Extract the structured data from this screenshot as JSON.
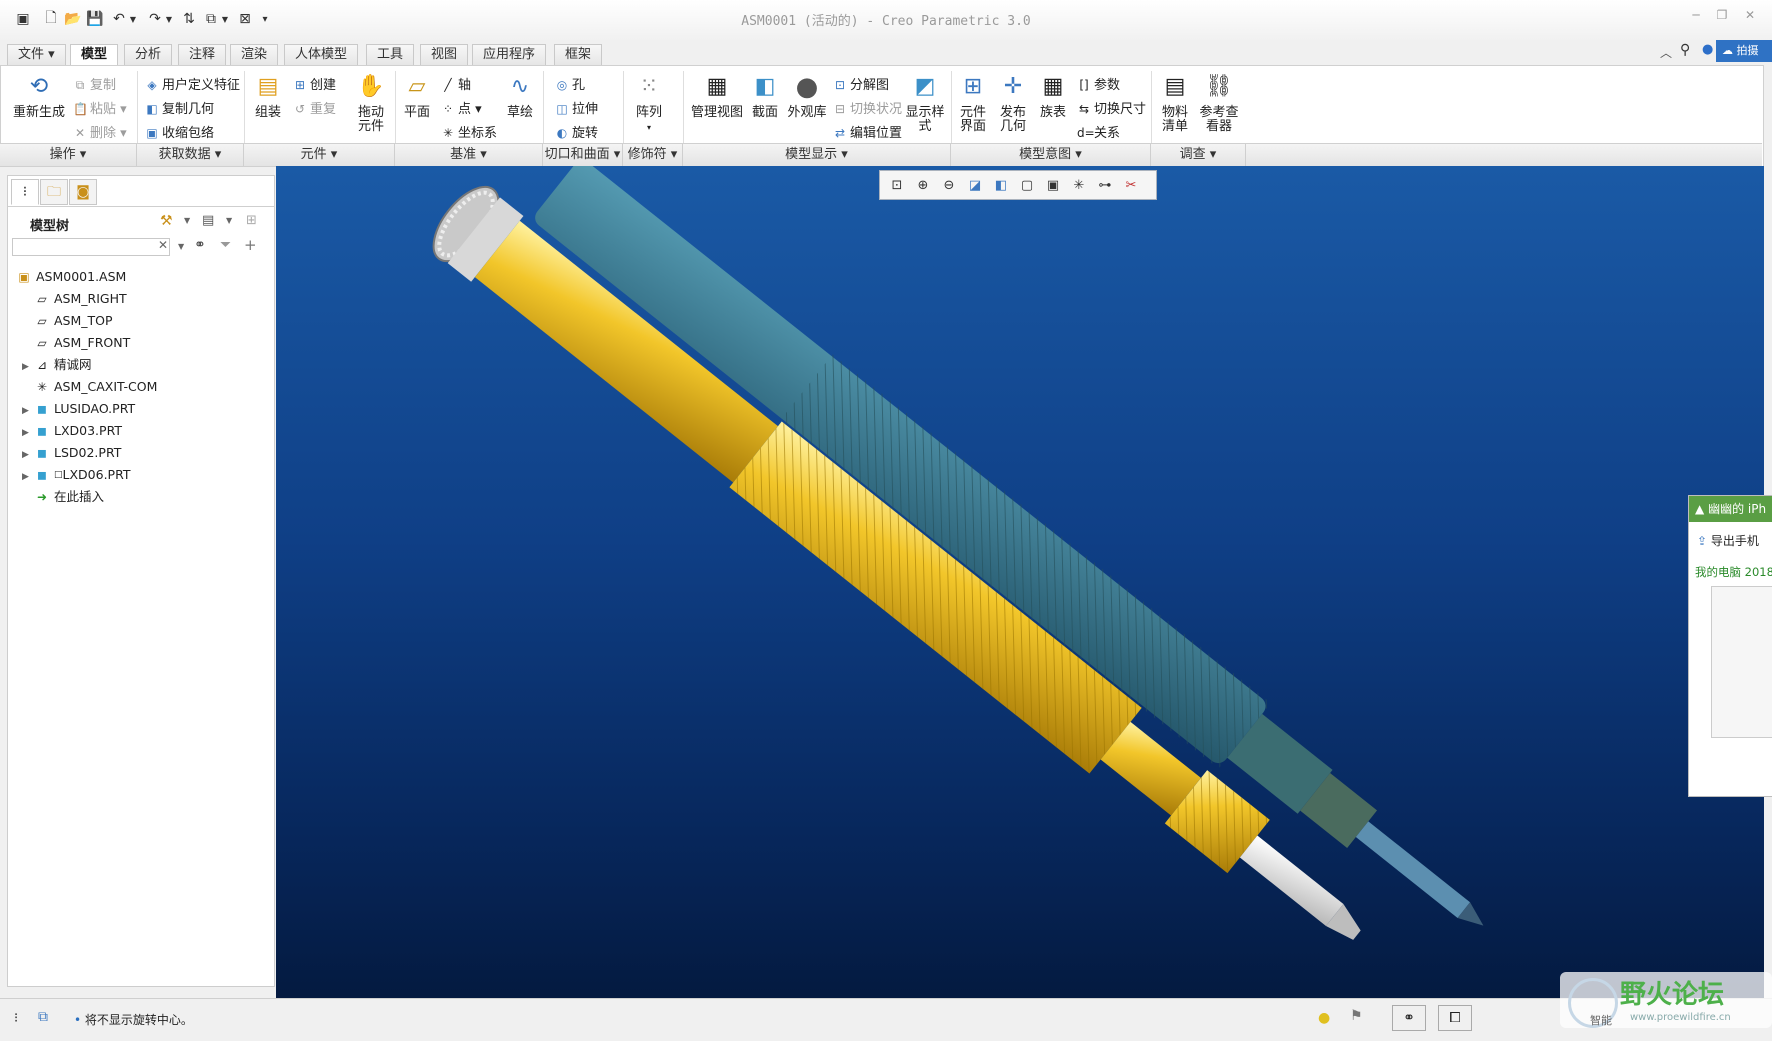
{
  "window": {
    "title": "ASM0001 (活动的) - Creo Parametric 3.0",
    "controls": [
      "minimize",
      "restore",
      "close"
    ]
  },
  "menu_tabs": [
    {
      "label": "文件",
      "has_dropdown": true
    },
    {
      "label": "模型",
      "active": true
    },
    {
      "label": "分析"
    },
    {
      "label": "注释"
    },
    {
      "label": "渲染"
    },
    {
      "label": "人体模型"
    },
    {
      "label": "工具"
    },
    {
      "label": "视图"
    },
    {
      "label": "应用程序"
    },
    {
      "label": "框架"
    }
  ],
  "ribbon": {
    "operations": {
      "regenerate": "重新生成",
      "copy": "复制",
      "paste": "粘贴",
      "delete": "删除"
    },
    "get_data": {
      "udf": "用户定义特征",
      "copy_geom": "复制几何",
      "shrinkwrap": "收缩包络"
    },
    "components": {
      "assemble": "组装",
      "create": "创建",
      "repeat": "重复",
      "drag": "拖动\n元件"
    },
    "datum": {
      "plane": "平面",
      "axis": "轴",
      "point": "点",
      "csys": "坐标系",
      "sketch": "草绘"
    },
    "cut_surface": {
      "hole": "孔",
      "extrude": "拉伸",
      "revolve": "旋转"
    },
    "modifiers": {
      "pattern": "阵列"
    },
    "model_display": {
      "manage_views": "管理视图",
      "section": "截面",
      "appearance": "外观库",
      "explode": "分解图",
      "toggle_state": "切换状况",
      "edit_position": "编辑位置",
      "display_style": "显示样\n式"
    },
    "model_intent": {
      "component_interface": "元件\n界面",
      "publish_geom": "发布\n几何",
      "family_table": "族表",
      "params": "参数",
      "switch_dims": "切换尺寸",
      "relations": "关系"
    },
    "investigate": {
      "bom": "物料\n清单",
      "ref_viewer": "参考查\n看器"
    },
    "groups": [
      "操作",
      "获取数据",
      "元件",
      "基准",
      "切口和曲面",
      "修饰符",
      "模型显示",
      "模型意图",
      "调查"
    ]
  },
  "left_panel": {
    "title": "模型树",
    "search_placeholder": "",
    "tree": [
      {
        "label": "ASM0001.ASM",
        "icon": "assembly-icon",
        "expandable": false,
        "level": 0
      },
      {
        "label": "ASM_RIGHT",
        "icon": "datum-plane-icon",
        "level": 1
      },
      {
        "label": "ASM_TOP",
        "icon": "datum-plane-icon",
        "level": 1
      },
      {
        "label": "ASM_FRONT",
        "icon": "datum-plane-icon",
        "level": 1
      },
      {
        "label": "精诚网",
        "icon": "layer-icon",
        "expandable": true,
        "level": 1
      },
      {
        "label": "ASM_CAXIT-COM",
        "icon": "csys-icon",
        "level": 1
      },
      {
        "label": "LUSIDAO.PRT",
        "icon": "part-icon",
        "expandable": true,
        "level": 1
      },
      {
        "label": "LXD03.PRT",
        "icon": "part-icon",
        "expandable": true,
        "level": 1
      },
      {
        "label": "LSD02.PRT",
        "icon": "part-icon",
        "expandable": true,
        "level": 1
      },
      {
        "label": "LXD06.PRT",
        "icon": "part-icon",
        "expandable": true,
        "level": 1,
        "prefix": "□"
      },
      {
        "label": "在此插入",
        "icon": "insert-here-icon",
        "level": 1
      }
    ]
  },
  "status": {
    "message": "将不显示旋转中心。"
  },
  "popup": {
    "title": "幽幽的 iPh",
    "action": "导出手机",
    "subtitle": "我的电脑 2018",
    "top_badge": "拍摄"
  },
  "watermark": {
    "brand": "野火论坛",
    "url": "www.proewildfire.cn",
    "label": "智能"
  },
  "colors": {
    "viewport_top": "#1a5aa6",
    "viewport_bottom": "#041a40",
    "yellow_part": "#e6b11e",
    "teal_part": "#3a7b8a",
    "accent": "#2f72c4"
  }
}
